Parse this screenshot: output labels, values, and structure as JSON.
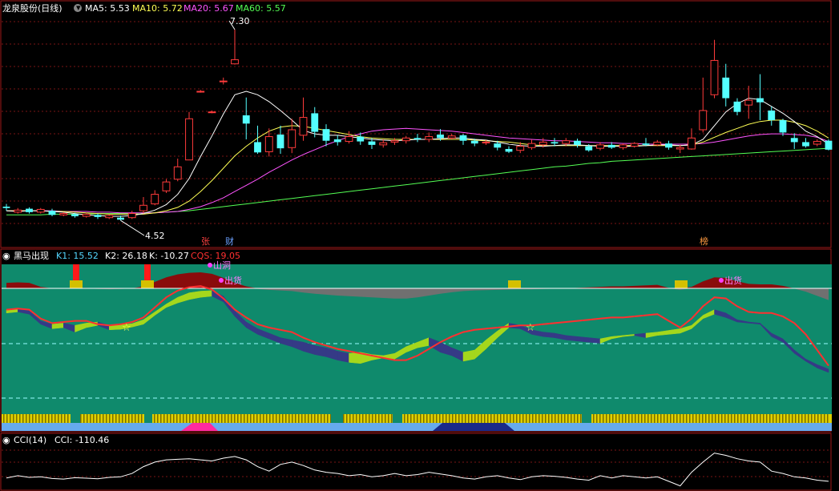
{
  "title": "龙泉股份(日线)",
  "colors": {
    "up": "#ff3b3b",
    "down": "#54ffff",
    "ma5": "#ffffff",
    "ma10": "#ffff54",
    "ma20": "#ff54ff",
    "ma60": "#54ff54",
    "grid": "#7a1414",
    "panelBg": "#0f8a6c",
    "k1": "#54d7ff",
    "k2": "#ffffff",
    "k": "#ffffff",
    "cqs": "#ff3030"
  },
  "main_legend": [
    {
      "label": "MA5:",
      "value": "5.53",
      "color_key": "ma5"
    },
    {
      "label": "MA10:",
      "value": "5.72",
      "color_key": "ma10"
    },
    {
      "label": "MA20:",
      "value": "5.67",
      "color_key": "ma20"
    },
    {
      "label": "MA60:",
      "value": "5.57",
      "color_key": "ma60"
    }
  ],
  "annotations": {
    "high_label": "7.30",
    "low_label": "4.52",
    "tags": [
      "张",
      "财",
      "榜"
    ]
  },
  "indicator": {
    "name": "黑马出现",
    "legend": [
      {
        "label": "K1:",
        "value": "15.52",
        "color_key": "k1"
      },
      {
        "label": "K2:",
        "value": "26.18",
        "color_key": "k2"
      },
      {
        "label": "K:",
        "value": "-10.27",
        "color_key": "k"
      },
      {
        "label": "CQS:",
        "value": "19.05",
        "color_key": "cqs"
      }
    ],
    "labels": [
      "山洞",
      "出货",
      "出货"
    ]
  },
  "cci": {
    "name": "CCI(14)",
    "label": "CCI:",
    "value": "-110.46"
  },
  "chart_data": [
    {
      "type": "candlestick",
      "title": "龙泉股份(日线)",
      "n": 73,
      "ylim": [
        4.3,
        7.45
      ],
      "ohlc": [
        [
          4.72,
          4.7,
          4.76,
          4.66
        ],
        [
          4.64,
          4.67,
          4.7,
          4.62
        ],
        [
          4.69,
          4.64,
          4.71,
          4.62
        ],
        [
          4.64,
          4.68,
          4.7,
          4.62
        ],
        [
          4.66,
          4.6,
          4.69,
          4.58
        ],
        [
          4.6,
          4.62,
          4.64,
          4.58
        ],
        [
          4.61,
          4.58,
          4.63,
          4.56
        ],
        [
          4.58,
          4.61,
          4.63,
          4.56
        ],
        [
          4.6,
          4.57,
          4.62,
          4.54
        ],
        [
          4.56,
          4.59,
          4.61,
          4.54
        ],
        [
          4.56,
          4.53,
          4.59,
          4.52
        ],
        [
          4.56,
          4.62,
          4.66,
          4.54
        ],
        [
          4.66,
          4.74,
          4.86,
          4.62
        ],
        [
          4.76,
          4.9,
          4.96,
          4.74
        ],
        [
          4.95,
          5.08,
          5.12,
          4.92
        ],
        [
          5.12,
          5.3,
          5.42,
          5.09
        ],
        [
          5.4,
          6.0,
          6.1,
          5.9
        ],
        [
          6.4,
          6.4,
          6.42,
          6.38
        ],
        [
          6.1,
          6.1,
          6.12,
          6.08
        ],
        [
          6.55,
          6.55,
          6.6,
          6.5
        ],
        [
          6.8,
          6.86,
          7.3,
          6.79
        ],
        [
          6.05,
          5.93,
          6.31,
          5.7
        ],
        [
          5.66,
          5.51,
          5.9,
          5.49
        ],
        [
          5.52,
          5.74,
          5.86,
          5.45
        ],
        [
          5.77,
          5.57,
          5.9,
          5.49
        ],
        [
          5.58,
          5.84,
          6.0,
          5.5
        ],
        [
          5.76,
          6.02,
          6.31,
          5.68
        ],
        [
          6.08,
          5.81,
          6.17,
          5.73
        ],
        [
          5.85,
          5.68,
          5.92,
          5.6
        ],
        [
          5.7,
          5.66,
          5.76,
          5.61
        ],
        [
          5.67,
          5.74,
          5.82,
          5.64
        ],
        [
          5.74,
          5.67,
          5.8,
          5.62
        ],
        [
          5.67,
          5.62,
          5.72,
          5.56
        ],
        [
          5.62,
          5.65,
          5.7,
          5.58
        ],
        [
          5.66,
          5.68,
          5.72,
          5.62
        ],
        [
          5.68,
          5.72,
          5.75,
          5.64
        ],
        [
          5.72,
          5.7,
          5.78,
          5.66
        ],
        [
          5.7,
          5.74,
          5.8,
          5.66
        ],
        [
          5.77,
          5.72,
          5.85,
          5.68
        ],
        [
          5.72,
          5.75,
          5.78,
          5.7
        ],
        [
          5.76,
          5.68,
          5.78,
          5.62
        ],
        [
          5.68,
          5.64,
          5.71,
          5.6
        ],
        [
          5.65,
          5.66,
          5.69,
          5.62
        ],
        [
          5.64,
          5.58,
          5.68,
          5.54
        ],
        [
          5.56,
          5.52,
          5.6,
          5.5
        ],
        [
          5.54,
          5.6,
          5.66,
          5.5
        ],
        [
          5.58,
          5.64,
          5.7,
          5.55
        ],
        [
          5.62,
          5.66,
          5.72,
          5.58
        ],
        [
          5.66,
          5.64,
          5.72,
          5.6
        ],
        [
          5.64,
          5.68,
          5.72,
          5.6
        ],
        [
          5.68,
          5.62,
          5.71,
          5.58
        ],
        [
          5.6,
          5.54,
          5.63,
          5.52
        ],
        [
          5.57,
          5.62,
          5.66,
          5.54
        ],
        [
          5.62,
          5.58,
          5.66,
          5.56
        ],
        [
          5.58,
          5.62,
          5.64,
          5.55
        ],
        [
          5.6,
          5.64,
          5.66,
          5.58
        ],
        [
          5.64,
          5.62,
          5.72,
          5.6
        ],
        [
          5.62,
          5.66,
          5.69,
          5.6
        ],
        [
          5.64,
          5.58,
          5.68,
          5.55
        ],
        [
          5.56,
          5.58,
          5.62,
          5.5
        ],
        [
          5.56,
          5.72,
          5.86,
          5.55
        ],
        [
          5.84,
          6.12,
          6.6,
          5.8
        ],
        [
          6.35,
          6.85,
          7.15,
          6.3
        ],
        [
          6.6,
          6.3,
          6.8,
          6.18
        ],
        [
          6.25,
          6.1,
          6.3,
          6.05
        ],
        [
          6.2,
          6.27,
          6.48,
          6.0
        ],
        [
          6.3,
          6.24,
          6.65,
          5.98
        ],
        [
          6.12,
          5.98,
          6.18,
          5.9
        ],
        [
          5.98,
          5.8,
          6.0,
          5.75
        ],
        [
          5.72,
          5.66,
          5.79,
          5.56
        ],
        [
          5.66,
          5.6,
          5.72,
          5.58
        ],
        [
          5.63,
          5.67,
          5.7,
          5.6
        ],
        [
          5.68,
          5.55,
          5.7,
          5.54
        ]
      ],
      "ma5": [
        4.66,
        4.65,
        4.66,
        4.66,
        4.65,
        4.64,
        4.62,
        4.6,
        4.59,
        4.58,
        4.58,
        4.59,
        4.62,
        4.67,
        4.75,
        4.9,
        5.13,
        5.45,
        5.75,
        6.07,
        6.35,
        6.4,
        6.35,
        6.25,
        6.12,
        5.98,
        5.83,
        5.78,
        5.76,
        5.76,
        5.74,
        5.72,
        5.7,
        5.69,
        5.68,
        5.69,
        5.7,
        5.7,
        5.71,
        5.72,
        5.72,
        5.7,
        5.69,
        5.66,
        5.63,
        5.61,
        5.6,
        5.6,
        5.61,
        5.62,
        5.62,
        5.61,
        5.6,
        5.6,
        5.6,
        5.6,
        5.61,
        5.62,
        5.62,
        5.61,
        5.62,
        5.7,
        5.9,
        6.1,
        6.22,
        6.3,
        6.28,
        6.18,
        6.08,
        5.96,
        5.82,
        5.74,
        5.63
      ],
      "ma10": [
        4.66,
        4.66,
        4.66,
        4.66,
        4.65,
        4.65,
        4.64,
        4.63,
        4.62,
        4.61,
        4.61,
        4.61,
        4.61,
        4.63,
        4.66,
        4.71,
        4.8,
        4.94,
        5.1,
        5.28,
        5.46,
        5.6,
        5.72,
        5.82,
        5.88,
        5.9,
        5.89,
        5.86,
        5.83,
        5.8,
        5.77,
        5.74,
        5.72,
        5.71,
        5.7,
        5.7,
        5.7,
        5.7,
        5.7,
        5.7,
        5.7,
        5.69,
        5.68,
        5.67,
        5.66,
        5.64,
        5.62,
        5.61,
        5.61,
        5.61,
        5.61,
        5.61,
        5.61,
        5.61,
        5.61,
        5.61,
        5.61,
        5.61,
        5.61,
        5.61,
        5.62,
        5.66,
        5.73,
        5.8,
        5.86,
        5.92,
        5.96,
        5.98,
        5.98,
        5.95,
        5.9,
        5.82,
        5.72
      ],
      "ma20": [
        4.66,
        4.66,
        4.66,
        4.66,
        4.66,
        4.65,
        4.65,
        4.65,
        4.64,
        4.64,
        4.63,
        4.63,
        4.63,
        4.63,
        4.64,
        4.65,
        4.68,
        4.72,
        4.78,
        4.85,
        4.94,
        5.03,
        5.12,
        5.22,
        5.31,
        5.4,
        5.48,
        5.55,
        5.62,
        5.68,
        5.74,
        5.78,
        5.82,
        5.84,
        5.85,
        5.86,
        5.85,
        5.84,
        5.83,
        5.82,
        5.8,
        5.78,
        5.76,
        5.74,
        5.72,
        5.71,
        5.7,
        5.69,
        5.68,
        5.68,
        5.67,
        5.66,
        5.65,
        5.65,
        5.64,
        5.64,
        5.63,
        5.63,
        5.63,
        5.63,
        5.63,
        5.64,
        5.66,
        5.69,
        5.72,
        5.75,
        5.77,
        5.78,
        5.78,
        5.77,
        5.76,
        5.73,
        5.67
      ],
      "ma60": [
        4.6,
        4.6,
        4.6,
        4.6,
        4.61,
        4.61,
        4.61,
        4.61,
        4.62,
        4.62,
        4.62,
        4.62,
        4.63,
        4.63,
        4.64,
        4.65,
        4.66,
        4.68,
        4.7,
        4.72,
        4.74,
        4.76,
        4.78,
        4.8,
        4.82,
        4.84,
        4.86,
        4.88,
        4.9,
        4.92,
        4.94,
        4.96,
        4.98,
        5.0,
        5.02,
        5.04,
        5.06,
        5.08,
        5.1,
        5.12,
        5.14,
        5.16,
        5.18,
        5.2,
        5.22,
        5.24,
        5.26,
        5.28,
        5.3,
        5.31,
        5.33,
        5.35,
        5.36,
        5.38,
        5.39,
        5.4,
        5.41,
        5.42,
        5.43,
        5.44,
        5.45,
        5.46,
        5.47,
        5.48,
        5.49,
        5.5,
        5.51,
        5.52,
        5.53,
        5.54,
        5.55,
        5.56,
        5.57
      ]
    },
    {
      "type": "area",
      "title": "黑马出现",
      "n": 73,
      "k1": [
        62,
        64,
        60,
        42,
        36,
        38,
        34,
        38,
        40,
        34,
        35,
        37,
        44,
        58,
        72,
        84,
        92,
        95,
        96,
        86,
        60,
        40,
        28,
        20,
        12,
        8,
        4,
        -2,
        -6,
        -12,
        -16,
        -14,
        -18,
        -20,
        -16,
        -4,
        4,
        12,
        4,
        -6,
        -14,
        -10,
        8,
        24,
        38,
        34,
        26,
        22,
        20,
        16,
        14,
        12,
        10,
        14,
        16,
        18,
        20,
        22,
        25,
        28,
        34,
        52,
        62,
        56,
        44,
        40,
        38,
        20,
        10,
        -10,
        -26,
        -36,
        -44
      ],
      "k2": [
        56,
        58,
        54,
        36,
        28,
        30,
        22,
        30,
        34,
        26,
        27,
        31,
        36,
        52,
        66,
        74,
        80,
        84,
        86,
        76,
        50,
        30,
        18,
        10,
        2,
        -4,
        -12,
        -18,
        -22,
        -28,
        -32,
        -34,
        -28,
        -24,
        -26,
        -14,
        -6,
        -2,
        -14,
        -20,
        -30,
        -26,
        -8,
        12,
        30,
        28,
        18,
        14,
        12,
        8,
        6,
        4,
        2,
        10,
        14,
        16,
        12,
        16,
        18,
        20,
        28,
        46,
        54,
        48,
        40,
        38,
        36,
        14,
        4,
        -16,
        -30,
        -42,
        -50
      ],
      "cqs": [
        62,
        64,
        62,
        46,
        38,
        40,
        42,
        42,
        36,
        34,
        36,
        40,
        48,
        66,
        84,
        96,
        102,
        104,
        98,
        82,
        62,
        48,
        36,
        30,
        26,
        22,
        12,
        4,
        -2,
        -8,
        -12,
        -16,
        -20,
        -24,
        -28,
        -28,
        -20,
        -8,
        4,
        14,
        22,
        26,
        28,
        30,
        32,
        34,
        34,
        36,
        38,
        40,
        42,
        44,
        46,
        48,
        48,
        50,
        52,
        54,
        42,
        30,
        46,
        68,
        84,
        82,
        68,
        58,
        56,
        56,
        50,
        38,
        18,
        -10,
        -38
      ]
    },
    {
      "type": "line",
      "title": "CCI(14)",
      "n": 73,
      "cci": [
        -80,
        -60,
        -75,
        -70,
        -85,
        -90,
        -78,
        -82,
        -88,
        -75,
        -70,
        -40,
        20,
        60,
        80,
        85,
        90,
        80,
        70,
        95,
        110,
        80,
        20,
        -20,
        40,
        60,
        30,
        -10,
        -30,
        -40,
        -60,
        -50,
        -70,
        -60,
        -40,
        -60,
        -50,
        -30,
        -45,
        -60,
        -80,
        -90,
        -70,
        -60,
        -80,
        -95,
        -70,
        -60,
        -65,
        -75,
        -90,
        -100,
        -60,
        -80,
        -60,
        -70,
        -80,
        -70,
        -110,
        -150,
        -30,
        60,
        140,
        120,
        90,
        70,
        60,
        -20,
        -40,
        -70,
        -80,
        -100,
        -110
      ],
      "ylim": [
        -160,
        180
      ]
    }
  ]
}
